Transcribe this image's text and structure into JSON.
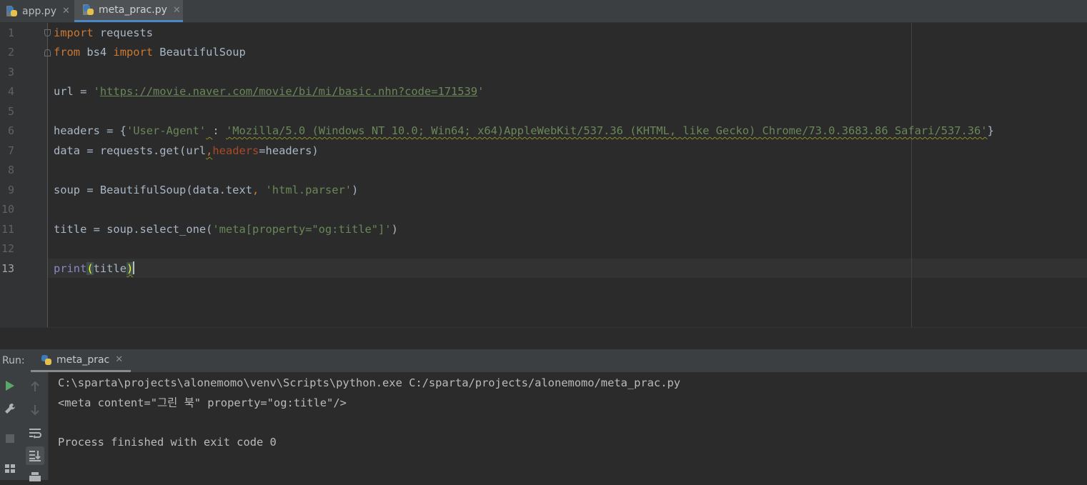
{
  "tabs": [
    {
      "label": "app.py",
      "active": false
    },
    {
      "label": "meta_prac.py",
      "active": true
    }
  ],
  "editor": {
    "line_numbers": [
      "1",
      "2",
      "3",
      "4",
      "5",
      "6",
      "7",
      "8",
      "9",
      "10",
      "11",
      "12",
      "13"
    ],
    "current_line": "13",
    "lines": {
      "l1": {
        "kw": "import",
        "rest": " requests"
      },
      "l2": {
        "kw1": "from",
        "mid": " bs4 ",
        "kw2": "import",
        "rest": " BeautifulSoup"
      },
      "l4": {
        "pre": "url = ",
        "q1": "'",
        "url": "https://movie.naver.com/movie/bi/mi/basic.nhn?code=171539",
        "q2": "'"
      },
      "l6": {
        "pre": "headers = {",
        "key": "'User-Agent'",
        "sp": " ",
        "colon": ":",
        "sp2": " ",
        "val": "'Mozilla/5.0 (Windows NT 10.0; Win64; x64)AppleWebKit/537.36 (KHTML, like Gecko) Chrome/73.0.3683.86 Safari/537.36'",
        "post": "}"
      },
      "l7": {
        "pre": "data = requests.get(url",
        "comma": ",",
        "param": "headers",
        "post": "=headers)"
      },
      "l9": {
        "pre": "soup = BeautifulSoup(data.text",
        "comma": ", ",
        "str": "'html.parser'",
        "post": ")"
      },
      "l11": {
        "pre": "title = soup.select_one(",
        "str": "'meta[property=\"og:title\"]'",
        "post": ")"
      },
      "l13": {
        "builtin": "print",
        "open": "(",
        "arg": "title",
        "close": ")"
      }
    }
  },
  "run_panel": {
    "label": "Run:",
    "tab_label": "meta_prac",
    "output": [
      "C:\\sparta\\projects\\alonemomo\\venv\\Scripts\\python.exe C:/sparta/projects/alonemomo/meta_prac.py",
      "<meta content=\"그린 북\" property=\"og:title\"/>",
      "",
      "Process finished with exit code 0"
    ]
  },
  "icons": {
    "file": "python-file-icon",
    "run": "run-icon",
    "settings": "wrench-icon",
    "stop": "stop-icon",
    "up": "arrow-up-icon",
    "down": "arrow-down-icon",
    "wrap": "soft-wrap-icon",
    "scroll": "scroll-to-end-icon",
    "layout": "layout-icon",
    "print": "print-icon"
  },
  "colors": {
    "keyword": "#cc7832",
    "string": "#6a8759",
    "builtin": "#8888c6",
    "param": "#aa4926",
    "text": "#a9b7c6",
    "run_green": "#59a869"
  }
}
